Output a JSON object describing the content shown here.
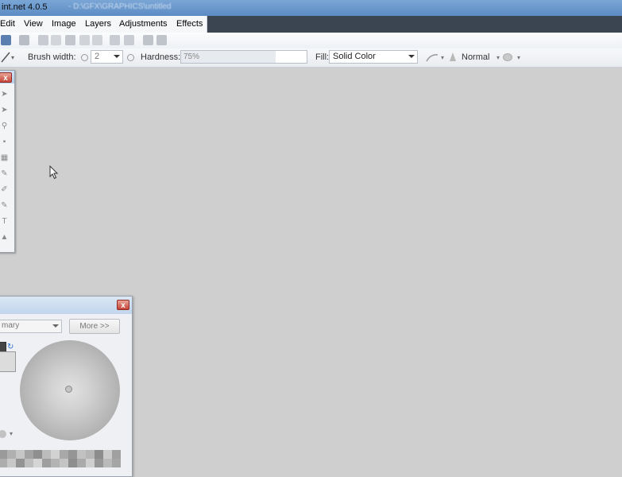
{
  "window": {
    "title": "int.net 4.0.5",
    "path": "- D:\\GFX\\GRAPHICS\\untitled"
  },
  "menu": {
    "items": [
      "Edit",
      "View",
      "Image",
      "Layers",
      "Adjustments",
      "Effects"
    ]
  },
  "toolbar": {
    "brush_width_label": "Brush width:",
    "brush_width_value": "2",
    "hardness_label": "Hardness:",
    "hardness_value": "75%",
    "hardness_fraction": 0.75,
    "fill_label": "Fill:",
    "fill_value": "Solid Color",
    "blend_mode": "Normal"
  },
  "tools_window": {
    "close_label": "x",
    "icons": [
      "arrow-icon",
      "move-icon",
      "zoom-icon",
      "pan-icon",
      "fill-icon",
      "rectangle-icon",
      "brush-icon",
      "pencil-icon",
      "clone-icon",
      "text-icon",
      "shape-icon"
    ]
  },
  "colors_window": {
    "close_label": "x",
    "mode_value": "mary",
    "more_label": "More >>",
    "palette": [
      "#9a9a9a",
      "#b0b0b0",
      "#c6c6c6",
      "#a3a3a3",
      "#8f8f8f",
      "#bcbcbc",
      "#d2d2d2",
      "#a8a8a8",
      "#959595",
      "#c1c1c1",
      "#b6b6b6",
      "#8c8c8c",
      "#cbcbcb",
      "#a0a0a0",
      "#adadad",
      "#c8c8c8",
      "#939393",
      "#bdbdbd",
      "#d5d5d5",
      "#9e9e9e",
      "#b3b3b3",
      "#c4c4c4",
      "#8e8e8e",
      "#aaaaaa",
      "#cfcfcf",
      "#979797",
      "#bababa",
      "#a5a5a5"
    ]
  },
  "colors": {
    "canvas_bg": "#cfcfcf",
    "accent_title": "#5c8cc4",
    "menubar_dark": "#3b4552"
  }
}
